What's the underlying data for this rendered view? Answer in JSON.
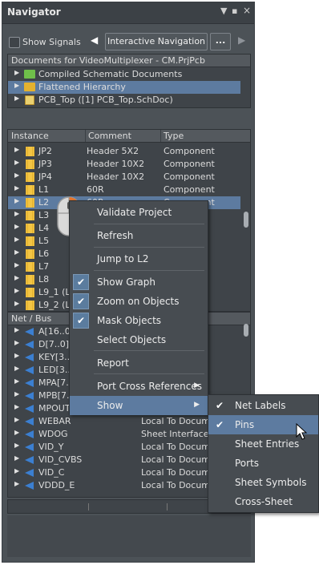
{
  "title": "Navigator",
  "title_buttons": [
    "▼",
    "▪",
    "×"
  ],
  "toolbar": {
    "show_signals_label": "Show Signals",
    "back": "◀",
    "interactive_nav_label": "Interactive Navigation",
    "more_label": "...",
    "forward": "▶"
  },
  "documents": {
    "header": "Documents for VideoMultiplexer - CM.PrjPcb",
    "items": [
      {
        "label": "Compiled Schematic Documents",
        "icon": "green-folder-icon"
      },
      {
        "label": "Flattened Hierarchy",
        "icon": "yellow-folder-icon"
      },
      {
        "label": "PCB_Top ([1] PCB_Top.SchDoc)",
        "icon": "document-icon"
      }
    ]
  },
  "instances": {
    "headers": {
      "instance": "Instance",
      "comment": "Comment",
      "type": "Type"
    },
    "rows": [
      {
        "instance": "JP2",
        "comment": "Header 5X2",
        "type": "Component"
      },
      {
        "instance": "JP3",
        "comment": "Header 10X2",
        "type": "Component"
      },
      {
        "instance": "JP4",
        "comment": "Header 10X2",
        "type": "Component"
      },
      {
        "instance": "L1",
        "comment": "60R",
        "type": "Component"
      },
      {
        "instance": "L2",
        "comment": "60R",
        "type": "Component"
      },
      {
        "instance": "L3",
        "comment": "",
        "type": ""
      },
      {
        "instance": "L4",
        "comment": "",
        "type": ""
      },
      {
        "instance": "L5",
        "comment": "",
        "type": ""
      },
      {
        "instance": "L6",
        "comment": "",
        "type": ""
      },
      {
        "instance": "L7",
        "comment": "",
        "type": ""
      },
      {
        "instance": "L8",
        "comment": "",
        "type": ""
      },
      {
        "instance": "L9_1 (L9",
        "comment": "",
        "type": ""
      },
      {
        "instance": "L9_2 (L9",
        "comment": "",
        "type": ""
      }
    ]
  },
  "nets": {
    "headers": {
      "net": "Net / Bus",
      "scope": ""
    },
    "rows": [
      {
        "net": "A[16..0]",
        "scope": "ent"
      },
      {
        "net": "D[7..0] E",
        "scope": "ent"
      },
      {
        "net": "KEY[3..0",
        "scope": ""
      },
      {
        "net": "LED[3..0",
        "scope": ""
      },
      {
        "net": "MPA[7..",
        "scope": ""
      },
      {
        "net": "MPB[7..",
        "scope": ""
      },
      {
        "net": "MPOUT",
        "scope": ""
      },
      {
        "net": "WEBAR",
        "scope": "Local To Docum"
      },
      {
        "net": "WDOG",
        "scope": "Sheet Interface"
      },
      {
        "net": "VID_Y",
        "scope": "Local To Docum"
      },
      {
        "net": "VID_CVBS",
        "scope": "Local To Docum"
      },
      {
        "net": "VID_C",
        "scope": "Local To Docum"
      },
      {
        "net": "VDDD_E",
        "scope": "Local To Docum"
      }
    ]
  },
  "context_menu": {
    "items": [
      {
        "label": "Validate Project",
        "checked": false
      },
      {
        "label": "Refresh",
        "checked": false
      },
      {
        "label": "Jump to L2",
        "checked": false
      },
      {
        "label": "Show Graph",
        "checked": true
      },
      {
        "label": "Zoom on Objects",
        "checked": true
      },
      {
        "label": "Mask Objects",
        "checked": true
      },
      {
        "label": "Select Objects",
        "checked": false
      },
      {
        "label": "Report",
        "checked": false
      },
      {
        "label": "Port Cross References",
        "checked": false,
        "submenu": true
      },
      {
        "label": "Show",
        "checked": false,
        "submenu": true,
        "highlighted": true
      }
    ],
    "submenu_arrow": "▶",
    "check_mark": "✔"
  },
  "show_submenu": {
    "items": [
      {
        "label": "Net Labels",
        "checked": true
      },
      {
        "label": "Pins",
        "checked": true,
        "highlighted": true
      },
      {
        "label": "Sheet Entries",
        "checked": false
      },
      {
        "label": "Ports",
        "checked": false
      },
      {
        "label": "Sheet Symbols",
        "checked": false
      },
      {
        "label": "Cross-Sheet",
        "checked": false
      }
    ]
  },
  "colors": {
    "panel_bg": "#4c5257",
    "list_bg": "#3f4449",
    "selection": "#5d7ba0",
    "menu_bg": "#474c51",
    "component_icon": "#f3c544",
    "net_icon": "#3b7fd1"
  }
}
